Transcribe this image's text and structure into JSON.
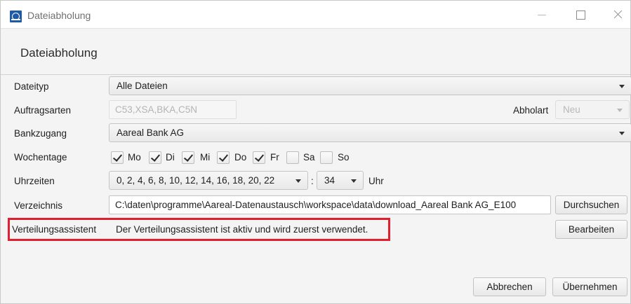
{
  "window": {
    "title": "Dateiabholung",
    "header_title": "Dateiabholung"
  },
  "form": {
    "dateityp": {
      "label": "Dateityp",
      "value": "Alle Dateien"
    },
    "auftragsarten": {
      "label": "Auftragsarten",
      "value": "C53,XSA,BKA,C5N"
    },
    "abholart": {
      "label": "Abholart",
      "value": "Neu"
    },
    "bankzugang": {
      "label": "Bankzugang",
      "value": "Aareal Bank AG"
    },
    "wochentage": {
      "label": "Wochentage",
      "days": [
        {
          "label": "Mo",
          "checked": true
        },
        {
          "label": "Di",
          "checked": true
        },
        {
          "label": "Mi",
          "checked": true
        },
        {
          "label": "Do",
          "checked": true
        },
        {
          "label": "Fr",
          "checked": true
        },
        {
          "label": "Sa",
          "checked": false
        },
        {
          "label": "So",
          "checked": false
        }
      ]
    },
    "uhrzeiten": {
      "label": "Uhrzeiten",
      "hours": "0, 2, 4, 6, 8, 10, 12, 14, 16, 18, 20, 22",
      "separator": ":",
      "minutes": "34",
      "unit": "Uhr"
    },
    "verzeichnis": {
      "label": "Verzeichnis",
      "value": "C:\\daten\\programme\\Aareal-Datenaustausch\\workspace\\data\\download_Aareal Bank AG_E100",
      "browse_label": "Durchsuchen"
    },
    "verteilungsassistent": {
      "label": "Verteilungsassistent",
      "status": "Der Verteilungsassistent ist aktiv und wird zuerst verwendet.",
      "edit_label": "Bearbeiten"
    }
  },
  "footer": {
    "cancel_label": "Abbrechen",
    "apply_label": "Übernehmen"
  },
  "colors": {
    "highlight": "#e0202e",
    "app_icon": "#1d5aa8"
  }
}
